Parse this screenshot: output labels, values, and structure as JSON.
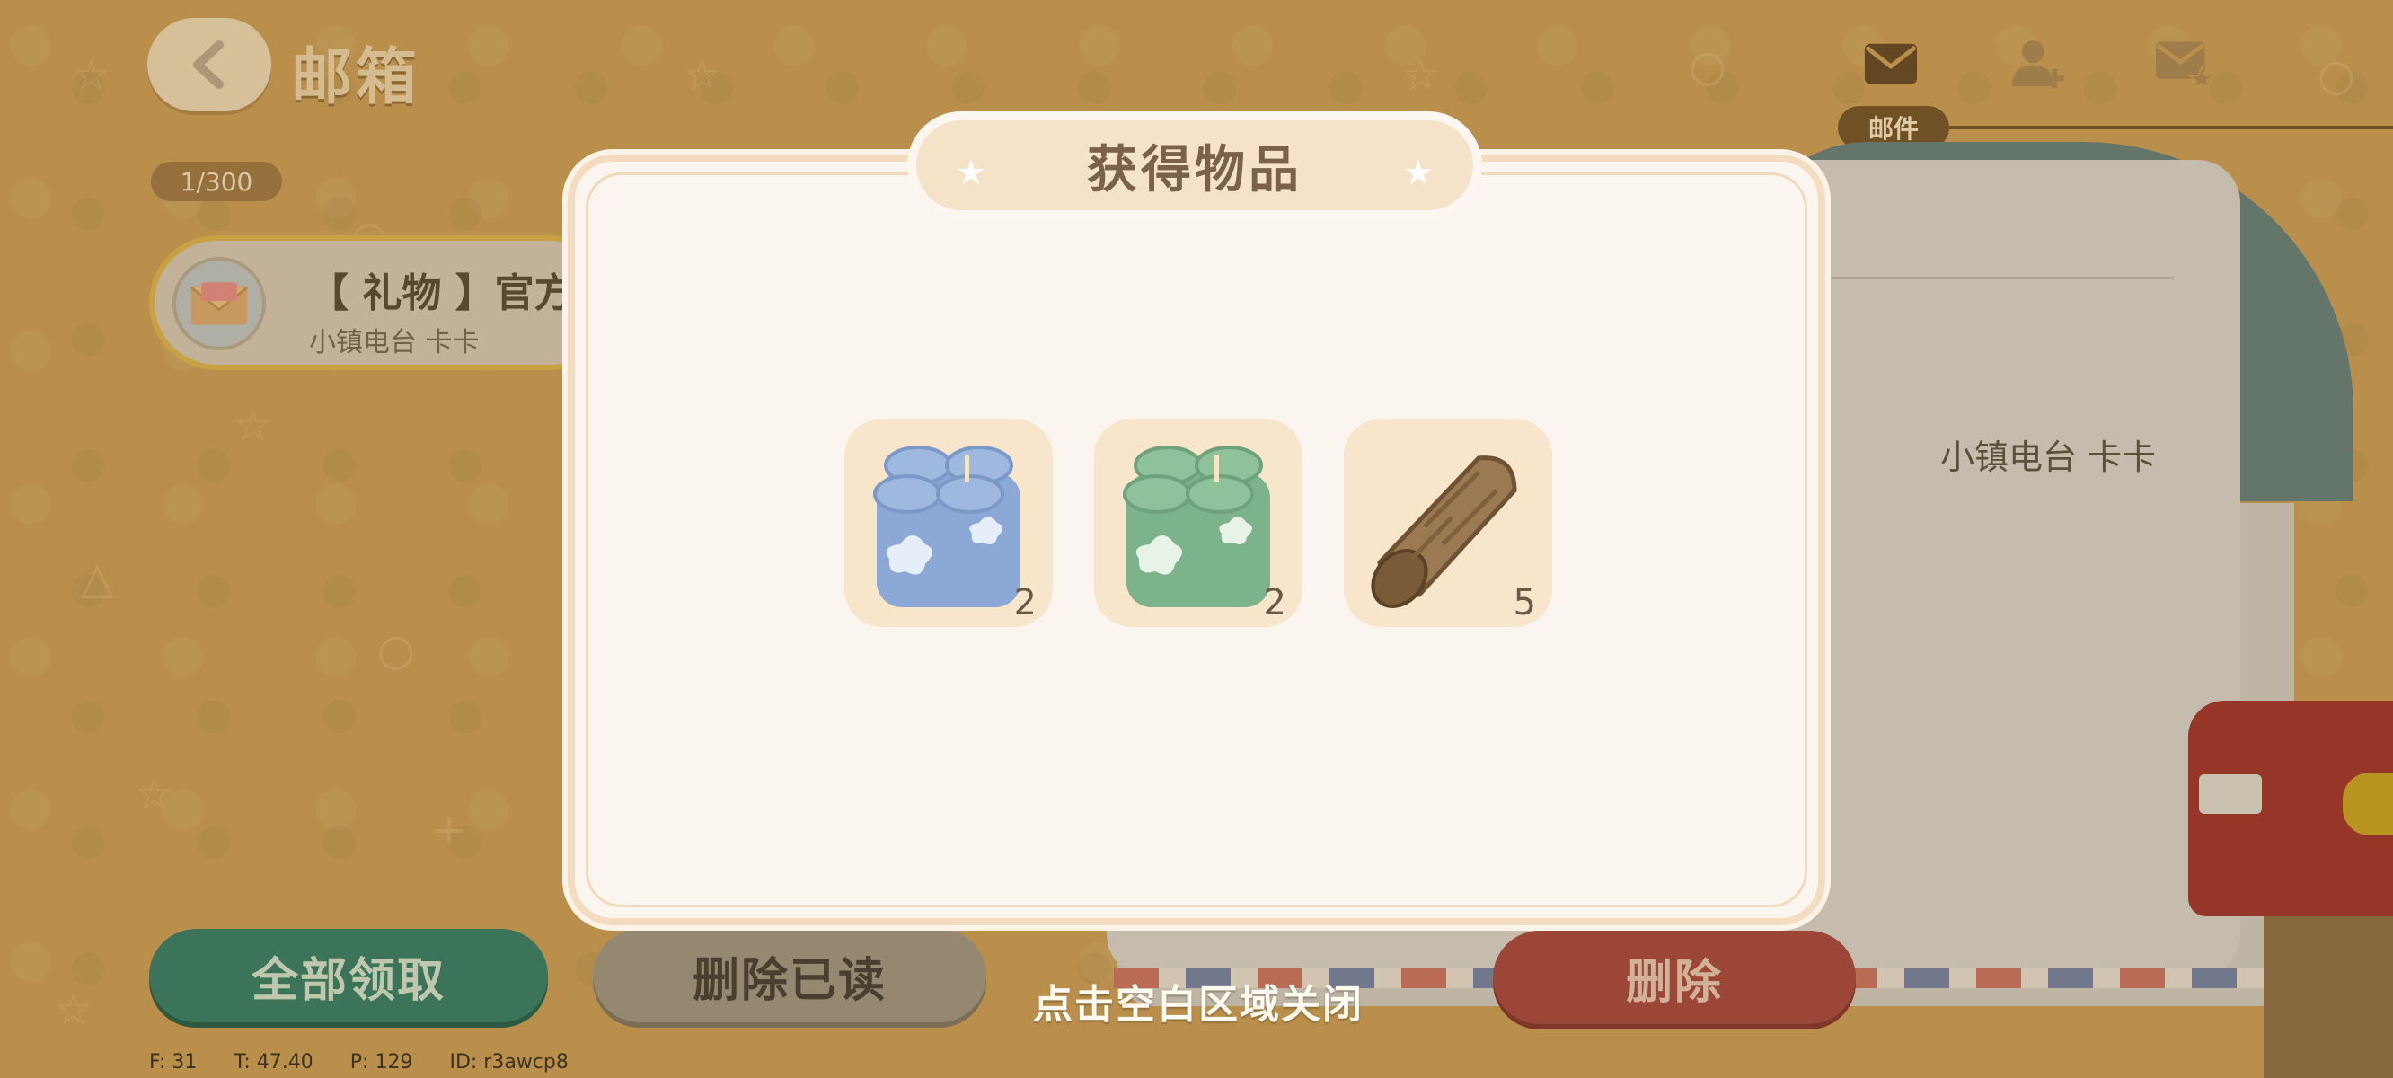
{
  "header": {
    "title": "邮箱",
    "mail_count": "1/300",
    "mail_tab_label": "邮件",
    "icons": [
      "mail-icon",
      "add-friend-icon",
      "starred-mail-icon",
      "back-arrow-icon"
    ]
  },
  "mail_list": [
    {
      "subject": "【 礼物 】官方直",
      "sender": "小镇电台 卡卡"
    }
  ],
  "detail": {
    "sender": "小镇电台 卡卡"
  },
  "buttons": {
    "claim_all": "全部领取",
    "delete_read": "删除已读",
    "delete": "删除"
  },
  "modal": {
    "title": "获得物品",
    "close_hint": "点击空白区域关闭",
    "items": [
      {
        "icon": "blue-candle-item-icon",
        "quantity": "2"
      },
      {
        "icon": "green-candle-item-icon",
        "quantity": "2"
      },
      {
        "icon": "wood-log-item-icon",
        "quantity": "5"
      }
    ]
  },
  "debug": {
    "fps": "F: 31",
    "temp": "T: 47.40",
    "ping": "P: 129",
    "id": "ID: r3awcp8"
  },
  "colors": {
    "background": "#c89c53",
    "claim_button": "#2f7b64",
    "delete_button": "#a3423a",
    "modal_bg": "#faf5ee",
    "slot_bg": "#f8e6cc"
  }
}
